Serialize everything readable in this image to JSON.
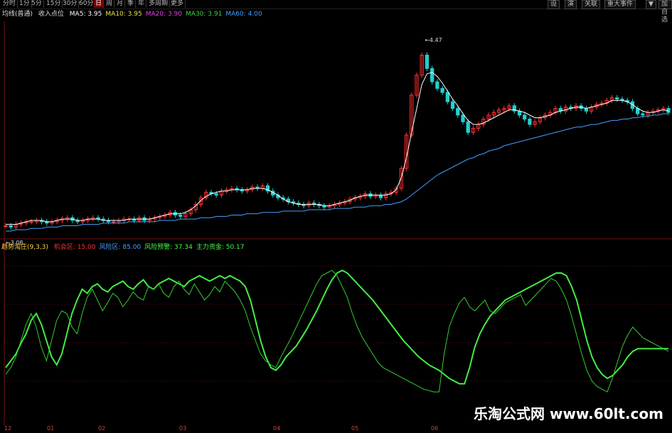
{
  "toolbar": {
    "periods": [
      "分时",
      "1分",
      "5分",
      "15分",
      "30分",
      "60分",
      "日",
      "周",
      "月",
      "季",
      "年",
      "多周期",
      "更多"
    ],
    "active_period": "日",
    "right_tools": [
      "设",
      "演",
      "关联",
      "重大事件",
      "▼",
      "加自选",
      "书"
    ]
  },
  "ma_legend": {
    "title": "均线(普通)",
    "subtitle": "收入点位",
    "items": [
      {
        "label": "MA5: 3.95",
        "color": "#ffffff"
      },
      {
        "label": "MA10: 3.95",
        "color": "#e8e84a"
      },
      {
        "label": "MA20: 3.90",
        "color": "#e040e0"
      },
      {
        "label": "MA30: 3.91",
        "color": "#40d040"
      },
      {
        "label": "MA60: 4.00",
        "color": "#40a0ff"
      }
    ]
  },
  "indicator_legend": {
    "name": "趋势淘庄(9,3,3)",
    "items": [
      {
        "label": "机会区: 15.00",
        "color": "#ff3030"
      },
      {
        "label": "风险区: 85.00",
        "color": "#40a0ff"
      },
      {
        "label": "风险预警: 37.34",
        "color": "#40ff40"
      },
      {
        "label": "主力资金: 50.17",
        "color": "#40ff40"
      }
    ]
  },
  "x_labels": [
    "12",
    "01",
    "02",
    "03",
    "04",
    "05",
    "06"
  ],
  "watermark": "乐淘公式网 www.60lt.com",
  "colors": {
    "up": "#ff3030",
    "down": "#20d0d0",
    "ma5": "#ffffff",
    "ma10": "#e8e84a",
    "ma20": "#e040e0",
    "ma30": "#40d040",
    "ma60": "#40a0ff",
    "fast": "#33cc33",
    "slow": "#44ee44"
  },
  "chart_data": [
    {
      "type": "candlestick",
      "y_range": [
        3.0,
        4.6
      ],
      "max_label": "4.47",
      "min_label": "3.08",
      "closes": [
        3.12,
        3.11,
        3.13,
        3.14,
        3.15,
        3.15,
        3.16,
        3.15,
        3.14,
        3.15,
        3.16,
        3.17,
        3.18,
        3.16,
        3.15,
        3.16,
        3.17,
        3.18,
        3.17,
        3.16,
        3.15,
        3.15,
        3.16,
        3.17,
        3.17,
        3.16,
        3.18,
        3.16,
        3.17,
        3.18,
        3.19,
        3.2,
        3.22,
        3.2,
        3.19,
        3.21,
        3.24,
        3.28,
        3.33,
        3.37,
        3.36,
        3.35,
        3.38,
        3.39,
        3.4,
        3.39,
        3.38,
        3.39,
        3.41,
        3.4,
        3.42,
        3.38,
        3.35,
        3.33,
        3.32,
        3.3,
        3.29,
        3.28,
        3.27,
        3.29,
        3.28,
        3.27,
        3.26,
        3.27,
        3.28,
        3.29,
        3.3,
        3.32,
        3.33,
        3.34,
        3.36,
        3.34,
        3.35,
        3.33,
        3.36,
        3.37,
        3.4,
        3.55,
        3.8,
        4.1,
        4.25,
        4.4,
        4.3,
        4.2,
        4.15,
        4.12,
        4.05,
        4.0,
        3.95,
        3.9,
        3.82,
        3.85,
        3.88,
        3.92,
        3.95,
        3.97,
        3.99,
        4.0,
        4.02,
        3.98,
        3.95,
        3.92,
        3.88,
        3.9,
        3.93,
        3.95,
        3.97,
        4.0,
        3.98,
        4.01,
        4.0,
        4.02,
        4.0,
        3.98,
        4.01,
        4.03,
        4.04,
        4.06,
        4.08,
        4.07,
        4.06,
        4.05,
        4.0,
        3.96,
        3.95,
        3.97,
        3.98,
        3.99,
        4.0,
        3.97
      ],
      "series": [
        {
          "name": "MA5",
          "values": [
            3.13,
            3.13,
            3.13,
            3.14,
            3.15,
            3.16,
            3.16,
            3.16,
            3.15,
            3.15,
            3.16,
            3.17,
            3.17,
            3.17,
            3.16,
            3.16,
            3.17,
            3.17,
            3.17,
            3.16,
            3.16,
            3.16,
            3.16,
            3.16,
            3.17,
            3.17,
            3.17,
            3.17,
            3.17,
            3.18,
            3.19,
            3.2,
            3.21,
            3.21,
            3.21,
            3.22,
            3.24,
            3.27,
            3.31,
            3.34,
            3.36,
            3.37,
            3.38,
            3.38,
            3.39,
            3.39,
            3.39,
            3.39,
            3.4,
            3.4,
            3.4,
            3.39,
            3.37,
            3.35,
            3.32,
            3.3,
            3.29,
            3.28,
            3.28,
            3.28,
            3.28,
            3.28,
            3.27,
            3.27,
            3.28,
            3.29,
            3.3,
            3.31,
            3.33,
            3.34,
            3.35,
            3.35,
            3.35,
            3.35,
            3.35,
            3.36,
            3.39,
            3.48,
            3.63,
            3.82,
            4.0,
            4.18,
            4.26,
            4.27,
            4.24,
            4.19,
            4.13,
            4.07,
            4.02,
            3.96,
            3.91,
            3.88,
            3.88,
            3.89,
            3.91,
            3.93,
            3.95,
            3.97,
            3.99,
            3.99,
            3.98,
            3.97,
            3.95,
            3.93,
            3.93,
            3.94,
            3.95,
            3.97,
            3.98,
            3.99,
            4.0,
            4.01,
            4.01,
            4.0,
            4.01,
            4.02,
            4.03,
            4.04,
            4.06,
            4.06,
            4.06,
            4.05,
            4.03,
            4.0,
            3.98,
            3.97,
            3.97,
            3.98,
            3.99,
            3.98
          ]
        },
        {
          "name": "MA60",
          "values": [
            3.08,
            3.08,
            3.09,
            3.09,
            3.09,
            3.1,
            3.1,
            3.1,
            3.11,
            3.11,
            3.11,
            3.12,
            3.12,
            3.12,
            3.12,
            3.13,
            3.13,
            3.13,
            3.13,
            3.14,
            3.14,
            3.14,
            3.14,
            3.14,
            3.15,
            3.15,
            3.15,
            3.15,
            3.15,
            3.15,
            3.16,
            3.16,
            3.16,
            3.16,
            3.17,
            3.17,
            3.17,
            3.17,
            3.18,
            3.18,
            3.18,
            3.19,
            3.19,
            3.19,
            3.2,
            3.2,
            3.2,
            3.21,
            3.21,
            3.21,
            3.22,
            3.22,
            3.22,
            3.22,
            3.23,
            3.23,
            3.23,
            3.23,
            3.23,
            3.24,
            3.24,
            3.24,
            3.24,
            3.24,
            3.25,
            3.25,
            3.25,
            3.25,
            3.26,
            3.26,
            3.26,
            3.27,
            3.27,
            3.27,
            3.28,
            3.28,
            3.29,
            3.3,
            3.32,
            3.35,
            3.38,
            3.41,
            3.44,
            3.47,
            3.5,
            3.52,
            3.54,
            3.56,
            3.58,
            3.6,
            3.62,
            3.63,
            3.65,
            3.66,
            3.68,
            3.69,
            3.7,
            3.72,
            3.73,
            3.74,
            3.75,
            3.76,
            3.77,
            3.78,
            3.79,
            3.8,
            3.81,
            3.82,
            3.83,
            3.84,
            3.85,
            3.86,
            3.86,
            3.87,
            3.88,
            3.88,
            3.89,
            3.9,
            3.91,
            3.91,
            3.92,
            3.92,
            3.93,
            3.93,
            3.94,
            3.94,
            3.95,
            3.95,
            3.96,
            3.96
          ]
        }
      ]
    },
    {
      "type": "line",
      "y_range": [
        0,
        100
      ],
      "series": [
        {
          "name": "主力资金",
          "values": [
            20,
            25,
            30,
            38,
            45,
            55,
            60,
            52,
            40,
            28,
            22,
            30,
            45,
            60,
            70,
            78,
            75,
            80,
            82,
            78,
            76,
            80,
            82,
            84,
            80,
            78,
            82,
            85,
            80,
            78,
            82,
            84,
            86,
            84,
            82,
            80,
            84,
            86,
            88,
            86,
            84,
            86,
            88,
            86,
            88,
            86,
            84,
            80,
            70,
            55,
            40,
            28,
            20,
            18,
            22,
            28,
            32,
            36,
            42,
            48,
            55,
            62,
            70,
            78,
            85,
            90,
            92,
            90,
            86,
            82,
            78,
            74,
            70,
            65,
            60,
            55,
            50,
            45,
            40,
            36,
            32,
            28,
            25,
            22,
            20,
            18,
            15,
            12,
            10,
            8,
            8,
            20,
            35,
            45,
            52,
            58,
            62,
            66,
            70,
            72,
            74,
            76,
            78,
            80,
            82,
            84,
            86,
            88,
            90,
            90,
            88,
            80,
            70,
            55,
            40,
            28,
            20,
            15,
            12,
            14,
            18,
            22,
            28,
            32,
            34,
            34,
            34,
            34,
            34,
            34,
            34
          ]
        },
        {
          "name": "风险预警",
          "values": [
            15,
            20,
            28,
            40,
            52,
            60,
            50,
            35,
            25,
            40,
            55,
            62,
            60,
            50,
            45,
            60,
            72,
            78,
            70,
            62,
            68,
            75,
            72,
            65,
            70,
            76,
            72,
            70,
            80,
            78,
            82,
            75,
            72,
            80,
            84,
            78,
            74,
            82,
            76,
            70,
            74,
            80,
            76,
            84,
            80,
            76,
            70,
            62,
            50,
            40,
            30,
            25,
            22,
            20,
            28,
            35,
            42,
            50,
            58,
            66,
            74,
            82,
            88,
            90,
            92,
            88,
            80,
            72,
            60,
            50,
            42,
            36,
            30,
            24,
            20,
            18,
            16,
            14,
            12,
            10,
            8,
            6,
            4,
            3,
            2,
            2,
            30,
            50,
            60,
            68,
            72,
            65,
            62,
            66,
            70,
            62,
            60,
            64,
            68,
            70,
            72,
            74,
            66,
            70,
            74,
            78,
            82,
            86,
            84,
            78,
            70,
            58,
            44,
            30,
            18,
            10,
            6,
            4,
            2,
            12,
            24,
            36,
            44,
            50,
            46,
            42,
            40,
            38,
            36,
            34,
            32
          ]
        }
      ]
    }
  ]
}
